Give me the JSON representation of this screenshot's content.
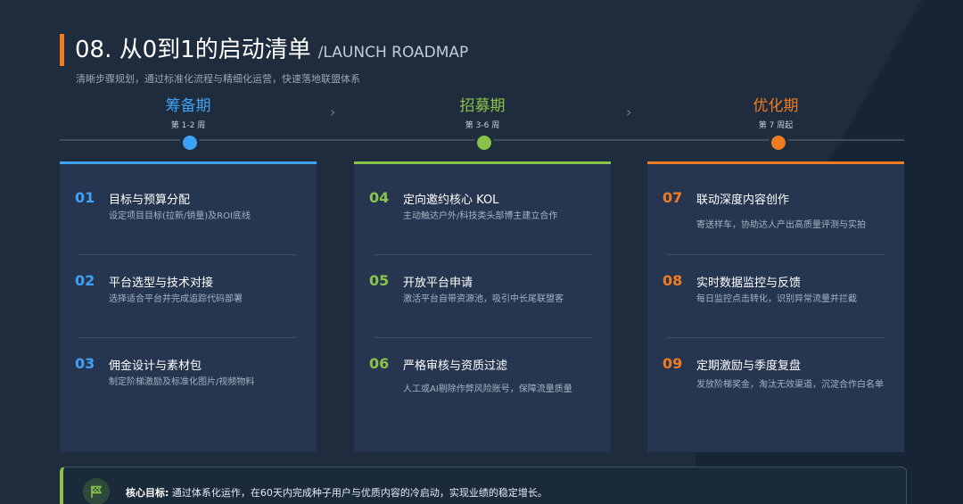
{
  "header": {
    "title": "08. 从0到1的启动清单",
    "title_en": "/LAUNCH ROADMAP",
    "subtitle": "清晰步骤规划，通过标准化流程与精细化运营，快速落地联盟体系"
  },
  "colors": {
    "blue": "#3fa2f5",
    "green": "#8bc34a",
    "orange": "#f07c22",
    "background": "#1e2c3e",
    "card": "#263650"
  },
  "phases": [
    {
      "name": "筹备期",
      "weeks": "第 1-2 周"
    },
    {
      "name": "招募期",
      "weeks": "第 3-6 周"
    },
    {
      "name": "优化期",
      "weeks": "第 7 周起"
    }
  ],
  "cards": [
    {
      "items": [
        {
          "num": "01",
          "title": "目标与预算分配",
          "desc": "设定项目目标(拉新/销量)及ROI底线"
        },
        {
          "num": "02",
          "title": "平台选型与技术对接",
          "desc": "选择适合平台并完成追踪代码部署"
        },
        {
          "num": "03",
          "title": "佣金设计与素材包",
          "desc": "制定阶梯激励及标准化图片/视频物料"
        }
      ]
    },
    {
      "items": [
        {
          "num": "04",
          "title": "定向邀约核心 KOL",
          "desc": "主动触达户外/科技类头部博主建立合作"
        },
        {
          "num": "05",
          "title": "开放平台申请",
          "desc": "激活平台自带资源池，吸引中长尾联盟客"
        },
        {
          "num": "06",
          "title": "严格审核与资质过滤",
          "desc": "人工或AI剔除作弊风险账号，保障流量质量"
        }
      ]
    },
    {
      "items": [
        {
          "num": "07",
          "title": "联动深度内容创作",
          "desc": "寄送样车，协助达人产出高质量评测与实拍"
        },
        {
          "num": "08",
          "title": "实时数据监控与反馈",
          "desc": "每日监控点击转化，识别异常流量并拦截"
        },
        {
          "num": "09",
          "title": "定期激励与季度复盘",
          "desc": "发放阶梯奖金，淘汰无效渠道，沉淀合作白名单"
        }
      ]
    }
  ],
  "footer": {
    "icon": "flag-icon",
    "label": "核心目标:",
    "text": "通过体系化运作，在60天内完成种子用户与优质内容的冷启动，实现业绩的稳定增长。"
  }
}
